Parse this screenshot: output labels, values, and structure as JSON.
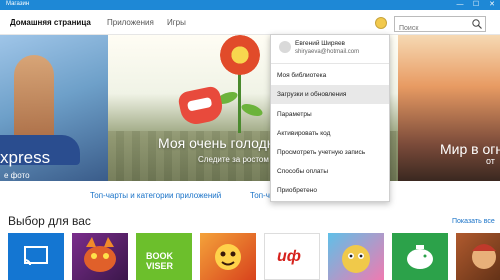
{
  "window": {
    "title": "Магазин",
    "controls": [
      "—",
      "☐",
      "✕"
    ]
  },
  "nav": {
    "tabs": [
      {
        "label": "Домашняя страница",
        "active": true
      },
      {
        "label": "Приложения",
        "active": false
      },
      {
        "label": "Игры",
        "active": false
      }
    ],
    "search": {
      "placeholder": "Поиск"
    }
  },
  "hero": {
    "left": {
      "title": "xpress",
      "subtitle": "е фото"
    },
    "main": {
      "title": "Моя очень голодн",
      "subtitle": "Следите за ростом п"
    },
    "right": {
      "title": "Мир в огне –",
      "subtitle": "от"
    },
    "dots": 5,
    "active_dot": 2
  },
  "links": {
    "top_charts": "Топ-чарты и категории приложений",
    "top_charts_2": "Топ-ч"
  },
  "section": {
    "title": "Выбор для вас",
    "show_all": "Показать все",
    "tiles": [
      {
        "color": "#1476d2",
        "icon": "cast-icon"
      },
      {
        "color": "#7a2d8c",
        "icon": "dragon-icon"
      },
      {
        "color": "#6cbf2c",
        "label": "BOOK VISER"
      },
      {
        "color": "#f4a23a",
        "icon": "game-icon"
      },
      {
        "color": "#ffffff",
        "label": "иф"
      },
      {
        "color": "#5fc0e8",
        "icon": "character-icon"
      },
      {
        "color": "#2ca24a",
        "icon": "piggy-bank-icon"
      },
      {
        "color": "#b05a2e",
        "icon": "game-icon"
      }
    ]
  },
  "account_menu": {
    "user_name": "Евгений Ширяев",
    "user_email": "shiryaeva@hotmail.com",
    "items": [
      {
        "label": "Моя библиотека"
      },
      {
        "label": "Загрузки и обновления",
        "highlighted": true
      },
      {
        "label": "Параметры"
      },
      {
        "label": "Активировать код"
      },
      {
        "label": "Просмотреть учетную запись"
      },
      {
        "label": "Способы оплаты"
      },
      {
        "label": "Приобретено"
      }
    ]
  }
}
